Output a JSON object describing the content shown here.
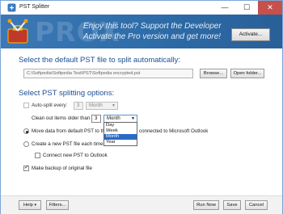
{
  "window": {
    "title": "PST Splitter",
    "min_glyph": "—",
    "max_glyph": "☐",
    "close_glyph": "✕"
  },
  "banner": {
    "watermark": "PROX",
    "promo_line1": "Enjoy this tool? Support the Developer",
    "promo_line2": "Activate the Pro version and get more!",
    "activate_label": "Activate..."
  },
  "source": {
    "heading": "Select the default PST file to split automatically:",
    "path": "C:\\Softpedia\\Softpedia Test\\PST\\Softpedia encrypted.pst",
    "browse_label": "Browse...",
    "open_folder_label": "Open folder..."
  },
  "options": {
    "heading": "Select PST splitting options:",
    "auto_split": {
      "label": "Auto-split every:",
      "checked": false,
      "count": "3",
      "unit": "Month"
    },
    "clean_out": {
      "label": "Clean out items older than",
      "count": "3",
      "unit": "Month"
    },
    "dropdown_options": [
      "Day",
      "Week",
      "Month",
      "Year"
    ],
    "dropdown_selected": "Month",
    "move_data": {
      "label": "Move data from default PST to the",
      "label_tail": "connected to Microsoft Outlook",
      "checked": true
    },
    "create_new": {
      "label": "Create a new PST file each time",
      "checked": false
    },
    "connect_new": {
      "label": "Connect new PST to Outlook",
      "checked": false
    },
    "make_backup": {
      "label": "Make backup of original file",
      "checked": true
    }
  },
  "footer": {
    "help_label": "Help",
    "filters_label": "Filters...",
    "run_now_label": "Run Now",
    "save_label": "Save",
    "cancel_label": "Cancel"
  },
  "colors": {
    "banner": "#2d6ca8",
    "heading": "#1c4e94",
    "close_button": "#c7504a",
    "selection": "#2a69c6"
  }
}
